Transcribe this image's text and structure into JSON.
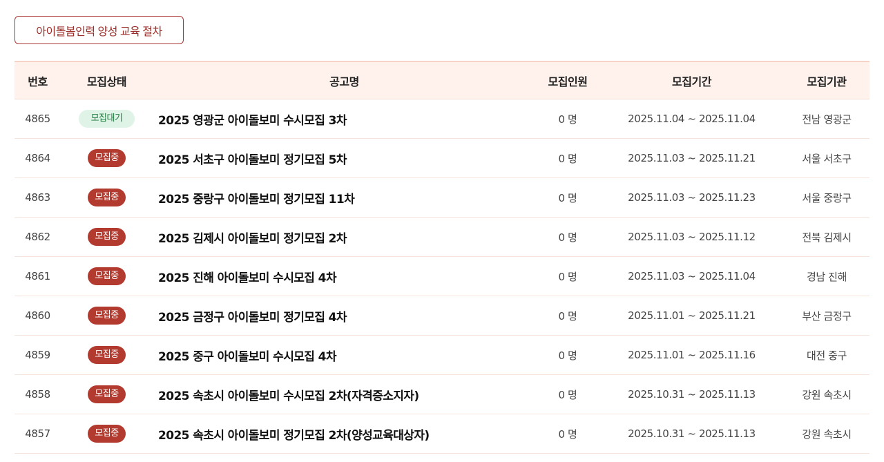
{
  "top_button": {
    "label": "아이돌봄인력 양성 교육 절차"
  },
  "table": {
    "headers": {
      "no": "번호",
      "status": "모집상태",
      "title": "공고명",
      "count": "모집인원",
      "period": "모집기간",
      "org": "모집기관"
    },
    "rows": [
      {
        "no": "4865",
        "status": "모집대기",
        "status_type": "wait",
        "title": "2025 영광군 아이돌보미 수시모집 3차",
        "count": "0 명",
        "period": "2025.11.04 ~ 2025.11.04",
        "org": "전남 영광군"
      },
      {
        "no": "4864",
        "status": "모집중",
        "status_type": "open",
        "title": "2025 서초구 아이돌보미 정기모집 5차",
        "count": "0 명",
        "period": "2025.11.03 ~ 2025.11.21",
        "org": "서울 서초구"
      },
      {
        "no": "4863",
        "status": "모집중",
        "status_type": "open",
        "title": "2025 중랑구 아이돌보미 정기모집 11차",
        "count": "0 명",
        "period": "2025.11.03 ~ 2025.11.23",
        "org": "서울 중랑구"
      },
      {
        "no": "4862",
        "status": "모집중",
        "status_type": "open",
        "title": "2025 김제시 아이돌보미 정기모집 2차",
        "count": "0 명",
        "period": "2025.11.03 ~ 2025.11.12",
        "org": "전북 김제시"
      },
      {
        "no": "4861",
        "status": "모집중",
        "status_type": "open",
        "title": "2025 진해 아이돌보미 수시모집 4차",
        "count": "0 명",
        "period": "2025.11.03 ~ 2025.11.04",
        "org": "경남 진해"
      },
      {
        "no": "4860",
        "status": "모집중",
        "status_type": "open",
        "title": "2025 금정구 아이돌보미 정기모집 4차",
        "count": "0 명",
        "period": "2025.11.01 ~ 2025.11.21",
        "org": "부산 금정구"
      },
      {
        "no": "4859",
        "status": "모집중",
        "status_type": "open",
        "title": "2025 중구 아이돌보미 수시모집 4차",
        "count": "0 명",
        "period": "2025.11.01 ~ 2025.11.16",
        "org": "대전 중구"
      },
      {
        "no": "4858",
        "status": "모집중",
        "status_type": "open",
        "title": "2025 속초시 아이돌보미 수시모집 2차(자격증소지자)",
        "count": "0 명",
        "period": "2025.10.31 ~ 2025.11.13",
        "org": "강원 속초시"
      },
      {
        "no": "4857",
        "status": "모집중",
        "status_type": "open",
        "title": "2025 속초시 아이돌보미 정기모집 2차(양성교육대상자)",
        "count": "0 명",
        "period": "2025.10.31 ~ 2025.11.13",
        "org": "강원 속초시"
      }
    ]
  },
  "colors": {
    "accent": "#a8322d",
    "header_bg": "#fff2ec",
    "badge_open": "#b23a2f",
    "badge_wait_bg": "#dff3e6",
    "badge_wait_text": "#1f7a3e"
  }
}
